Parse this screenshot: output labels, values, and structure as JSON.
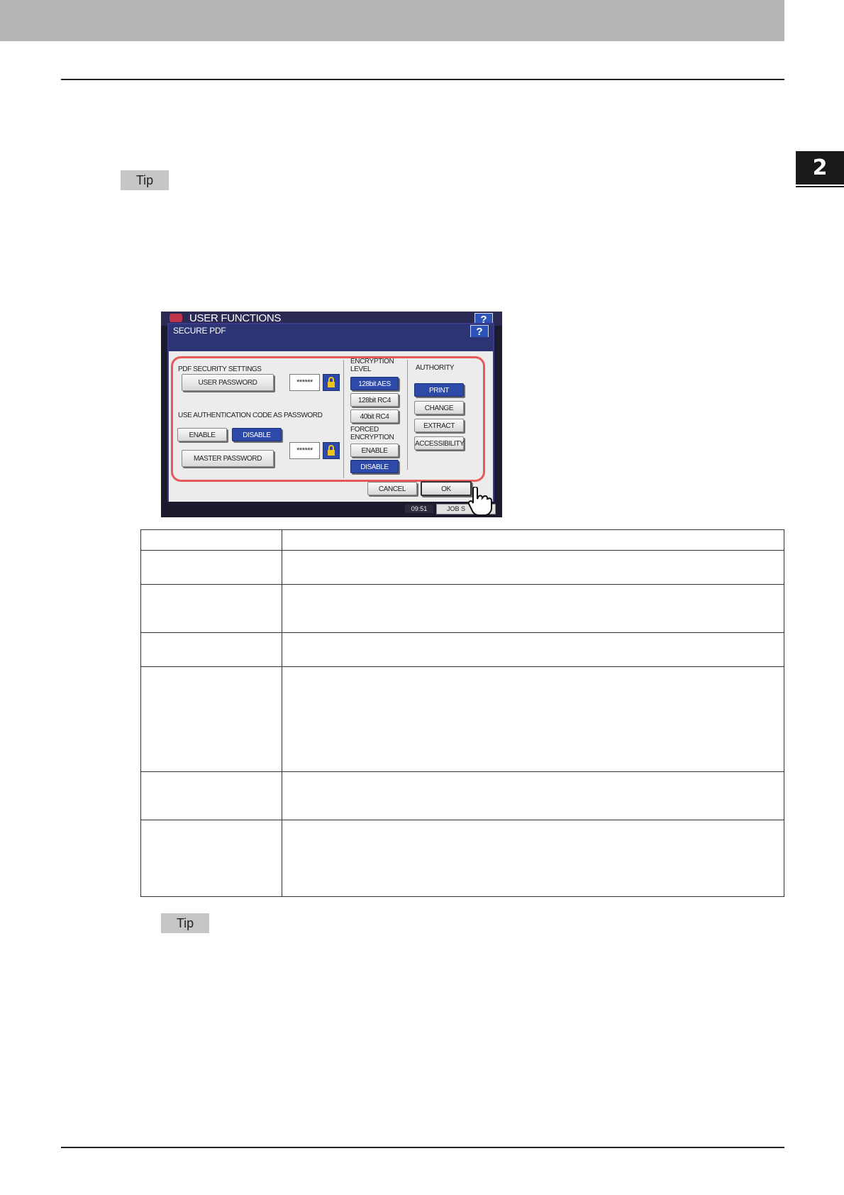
{
  "page": {
    "chapter_number": "2",
    "tip_label_1": "Tip",
    "tip_label_2": "Tip"
  },
  "screenshot": {
    "outer_title": "USER FUNCTIONS",
    "dialog_title": "SECURE PDF",
    "help_label": "?",
    "pdf_security_settings_label": "PDF SECURITY SETTINGS",
    "user_password_button": "USER PASSWORD",
    "user_password_value": "******",
    "use_auth_code_label": "USE AUTHENTICATION CODE AS PASSWORD",
    "auth_enable_button": "ENABLE",
    "auth_disable_button": "DISABLE",
    "master_password_button": "MASTER PASSWORD",
    "master_password_value": "******",
    "encryption_level_label": "ENCRYPTION LEVEL",
    "encryption_options": [
      "128bit AES",
      "128bit RC4",
      "40bit RC4"
    ],
    "encryption_selected": "128bit AES",
    "forced_encryption_label": "FORCED ENCRYPTION",
    "forced_enable_button": "ENABLE",
    "forced_disable_button": "DISABLE",
    "authority_label": "AUTHORITY",
    "authority_options": [
      "PRINT",
      "CHANGE",
      "EXTRACT",
      "ACCESSIBILITY"
    ],
    "authority_selected": "PRINT",
    "cancel_button": "CANCEL",
    "ok_button": "OK",
    "status_time": "09:51",
    "status_button": "JOB S"
  },
  "colors": {
    "selected_button": "#2d4aa8",
    "highlight_frame": "#e6595a",
    "title_bar": "#2c3474"
  },
  "table": {
    "row_count": 7
  }
}
